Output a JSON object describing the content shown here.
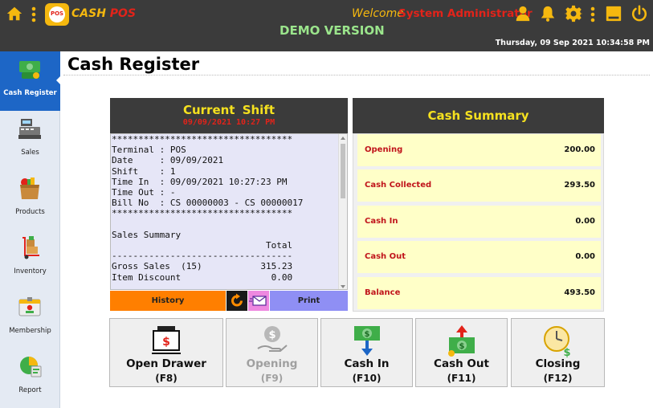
{
  "header": {
    "brand_cash": "CASH",
    "brand_pos": "POS",
    "logo_text": "POS",
    "welcome": "Welcome",
    "user": "System Administrator",
    "demo": "DEMO VERSION",
    "datetime": "Thursday, 09 Sep 2021 10:34:58 PM",
    "icons": [
      "home-icon",
      "menu-icon",
      "user-icon",
      "bell-icon",
      "gear-icon",
      "menu-icon",
      "minimize-icon",
      "power-icon"
    ]
  },
  "sidebar": {
    "items": [
      {
        "label": "Cash Register",
        "icon": "cash-register-icon",
        "active": true
      },
      {
        "label": "Sales",
        "icon": "cash-machine-icon",
        "active": false
      },
      {
        "label": "Products",
        "icon": "grocery-bag-icon",
        "active": false
      },
      {
        "label": "Inventory",
        "icon": "hand-truck-icon",
        "active": false
      },
      {
        "label": "Membership",
        "icon": "id-card-icon",
        "active": false
      },
      {
        "label": "Report",
        "icon": "report-icon",
        "active": false
      }
    ]
  },
  "page": {
    "title": "Cash Register"
  },
  "shift": {
    "title": "Current Shift",
    "datetime": "09/09/2021 10:27 PM",
    "receipt_lines": [
      "**********************************",
      "Terminal : POS",
      "Date     : 09/09/2021",
      "Shift    : 1",
      "Time In  : 09/09/2021 10:27:23 PM",
      "Time Out : -",
      "Bill No  : CS 00000003 - CS 00000017",
      "**********************************",
      "",
      "Sales Summary",
      "                             Total",
      "----------------------------------",
      "Gross Sales  (15)           315.23",
      "Item Discount                 0.00"
    ],
    "history_label": "History",
    "print_label": "Print"
  },
  "summary": {
    "title": "Cash Summary",
    "rows": [
      {
        "label": "Opening",
        "value": "200.00"
      },
      {
        "label": "Cash Collected",
        "value": "293.50"
      },
      {
        "label": "Cash In",
        "value": "0.00"
      },
      {
        "label": "Cash Out",
        "value": "0.00"
      },
      {
        "label": "Balance",
        "value": "493.50"
      }
    ]
  },
  "actions": [
    {
      "label": "Open Drawer",
      "key": "(F8)",
      "icon": "drawer-icon",
      "enabled": true
    },
    {
      "label": "Opening",
      "key": "(F9)",
      "icon": "money-hand-icon",
      "enabled": false
    },
    {
      "label": "Cash In",
      "key": "(F10)",
      "icon": "cash-in-icon",
      "enabled": true
    },
    {
      "label": "Cash Out",
      "key": "(F11)",
      "icon": "cash-out-icon",
      "enabled": true
    },
    {
      "label": "Closing",
      "key": "(F12)",
      "icon": "clock-money-icon",
      "enabled": true
    }
  ],
  "colors": {
    "accent": "#1d66c6",
    "topbar": "#3b3b3b",
    "gold": "#f5b80f",
    "red": "#e2231a",
    "summary_row": "#ffffc8"
  }
}
